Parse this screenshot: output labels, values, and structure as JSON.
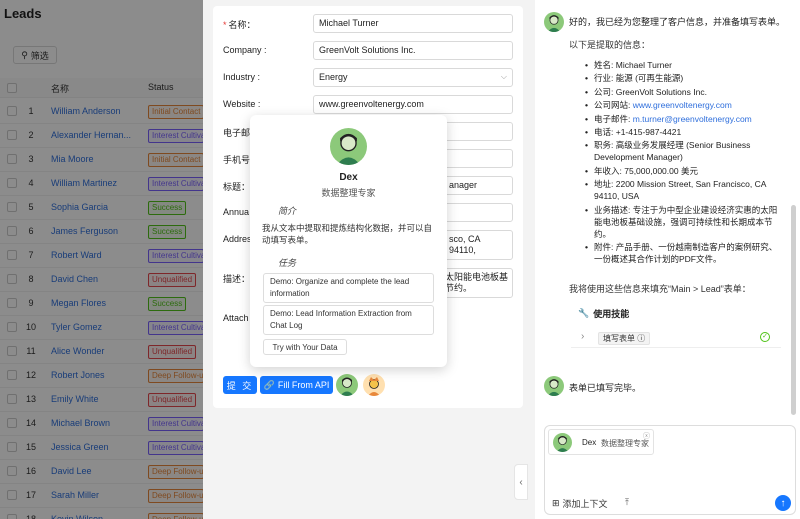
{
  "leads": {
    "title": "Leads",
    "filter_label": "筛选",
    "columns": {
      "name": "名称",
      "status": "Status"
    },
    "rows": [
      {
        "num": "1",
        "name": "William Anderson",
        "status": "Initial Contact",
        "color": "#e8883b"
      },
      {
        "num": "2",
        "name": "Alexander Hernan...",
        "status": "Interest Cultiva",
        "color": "#7b61ff"
      },
      {
        "num": "3",
        "name": "Mia Moore",
        "status": "Initial Contact",
        "color": "#e8883b"
      },
      {
        "num": "4",
        "name": "William Martinez",
        "status": "Interest Cultiva",
        "color": "#7b61ff"
      },
      {
        "num": "5",
        "name": "Sophia Garcia",
        "status": "Success",
        "color": "#52c41a"
      },
      {
        "num": "6",
        "name": "James Ferguson",
        "status": "Success",
        "color": "#52c41a"
      },
      {
        "num": "7",
        "name": "Robert Ward",
        "status": "Interest Cultiva",
        "color": "#7b61ff"
      },
      {
        "num": "8",
        "name": "David Chen",
        "status": "Unqualified",
        "color": "#e5484d"
      },
      {
        "num": "9",
        "name": "Megan Flores",
        "status": "Success",
        "color": "#52c41a"
      },
      {
        "num": "10",
        "name": "Tyler Gomez",
        "status": "Interest Cultiva",
        "color": "#7b61ff"
      },
      {
        "num": "11",
        "name": "Alice Wonder",
        "status": "Unqualified",
        "color": "#e5484d"
      },
      {
        "num": "12",
        "name": "Robert Jones",
        "status": "Deep Follow-u",
        "color": "#e8883b"
      },
      {
        "num": "13",
        "name": "Emily White",
        "status": "Unqualified",
        "color": "#e5484d"
      },
      {
        "num": "14",
        "name": "Michael Brown",
        "status": "Interest Cultiva",
        "color": "#7b61ff"
      },
      {
        "num": "15",
        "name": "Jessica Green",
        "status": "Interest Cultiva",
        "color": "#7b61ff"
      },
      {
        "num": "16",
        "name": "David Lee",
        "status": "Deep Follow-u",
        "color": "#e8883b"
      },
      {
        "num": "17",
        "name": "Sarah Miller",
        "status": "Deep Follow-u",
        "color": "#e8883b"
      },
      {
        "num": "18",
        "name": "Kevin Wilson",
        "status": "Deep Follow-u",
        "color": "#e8883b"
      }
    ]
  },
  "form": {
    "name_label": "名称：",
    "name_value": "Michael Turner",
    "company_label": "Company :",
    "company_value": "GreenVolt Solutions Inc.",
    "industry_label": "Industry :",
    "industry_value": "Energy",
    "website_label": "Website :",
    "website_value": "www.greenvoltenergy.com",
    "email_label": "电子邮",
    "phone_label": "手机号",
    "title_label": "标题：",
    "title_value_partial": "anager",
    "revenue_label": "Annua",
    "address_label": "Addres",
    "address_value_partial": "sco, CA 94110,",
    "desc_label": "描述：",
    "desc_value_partial": "太阳能电池板基\n节约。",
    "attach_label": "Attach",
    "submit_label": "提 交",
    "api_label": "Fill From API"
  },
  "popover": {
    "name": "Dex",
    "role": "数据整理专家",
    "intro_heading": "简介",
    "intro": "我从文本中提取和提炼结构化数据，并可以自动填写表单。",
    "tasks_heading": "任务",
    "tasks": [
      "Demo: Organize and complete the lead information",
      "Demo: Lead Information Extraction from Chat Log"
    ],
    "try_label": "Try with Your Data"
  },
  "chat": {
    "msg1": "好的，我已经为您整理了客户信息，并准备填写表单。",
    "msg1_sub": "以下是提取的信息：",
    "info": [
      {
        "k": "姓名: ",
        "v": "Michael Turner"
      },
      {
        "k": "行业: ",
        "v": "能源 (可再生能源)"
      },
      {
        "k": "公司: ",
        "v": "GreenVolt Solutions Inc."
      },
      {
        "k": "公司网站: ",
        "v": "www.greenvoltenergy.com",
        "link": true
      },
      {
        "k": "电子邮件: ",
        "v": "m.turner@greenvoltenergy.com",
        "link": true
      },
      {
        "k": "电话: ",
        "v": "+1-415-987-4421"
      },
      {
        "k": "职务: ",
        "v": "高级业务发展经理 (Senior Business Development Manager)"
      },
      {
        "k": "年收入: ",
        "v": "75,000,000.00 美元"
      },
      {
        "k": "地址: ",
        "v": "2200 Mission Street, San Francisco, CA 94110, USA"
      },
      {
        "k": "业务描述: ",
        "v": "专注于为中型企业建设经济实惠的太阳能电池板基础设施，强调可持续性和长期成本节约。"
      },
      {
        "k": "附件: ",
        "v": "产品手册、一份越南制造客户的案例研究、一份概述其合作计划的PDF文件。"
      }
    ],
    "msg_next": "我将使用这些信息来填充“Main > Lead”表单：",
    "skill_title": "使用技能",
    "skill_tag": "填写表单",
    "msg2": "表单已填写完毕。",
    "chip_name": "Dex",
    "chip_role": "数据整理专家",
    "ctx_label": "添加上下文"
  }
}
